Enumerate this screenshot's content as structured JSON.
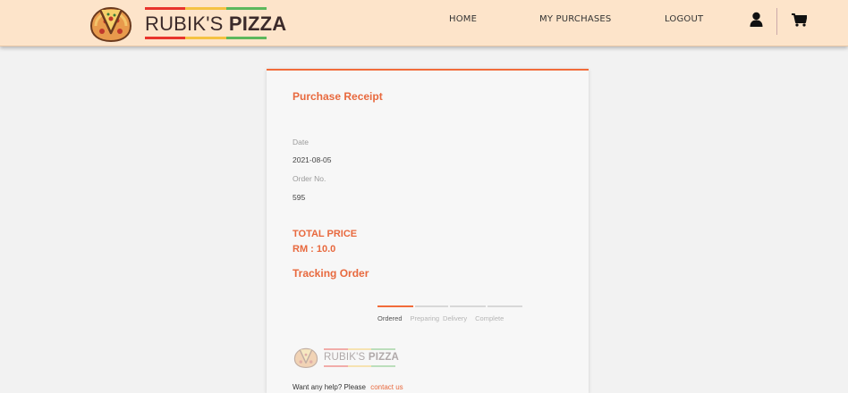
{
  "nav": {
    "brand_plain": "RUBIK'S",
    "brand_bold": "PIZZA",
    "home": "HOME",
    "purchases": "MY PURCHASES",
    "logout": "LOGOUT",
    "user_icon": "user-icon",
    "cart_icon": "cart-icon"
  },
  "receipt": {
    "title": "Purchase Receipt",
    "date_label": "Date",
    "date_value": "2021-08-05",
    "order_label": "Order No.",
    "order_value": "595",
    "total_label": "TOTAL PRICE",
    "total_value": "RM : 10.0",
    "tracking_title": "Tracking Order",
    "steps": [
      "Ordered",
      "Preparing",
      "Delivery",
      "Complete"
    ],
    "current_step": 1
  },
  "footer": {
    "brand_plain": "RUBIK'S",
    "brand_bold": "PIZZA",
    "help_text": "Want any help? Please",
    "contact_link": "contact us"
  },
  "colors": {
    "accent": "#f26b3a",
    "nav_bg": "#fde4ca",
    "stripe_red": "#e8342c",
    "stripe_yellow": "#f5c242",
    "stripe_green": "#5cb85c"
  }
}
